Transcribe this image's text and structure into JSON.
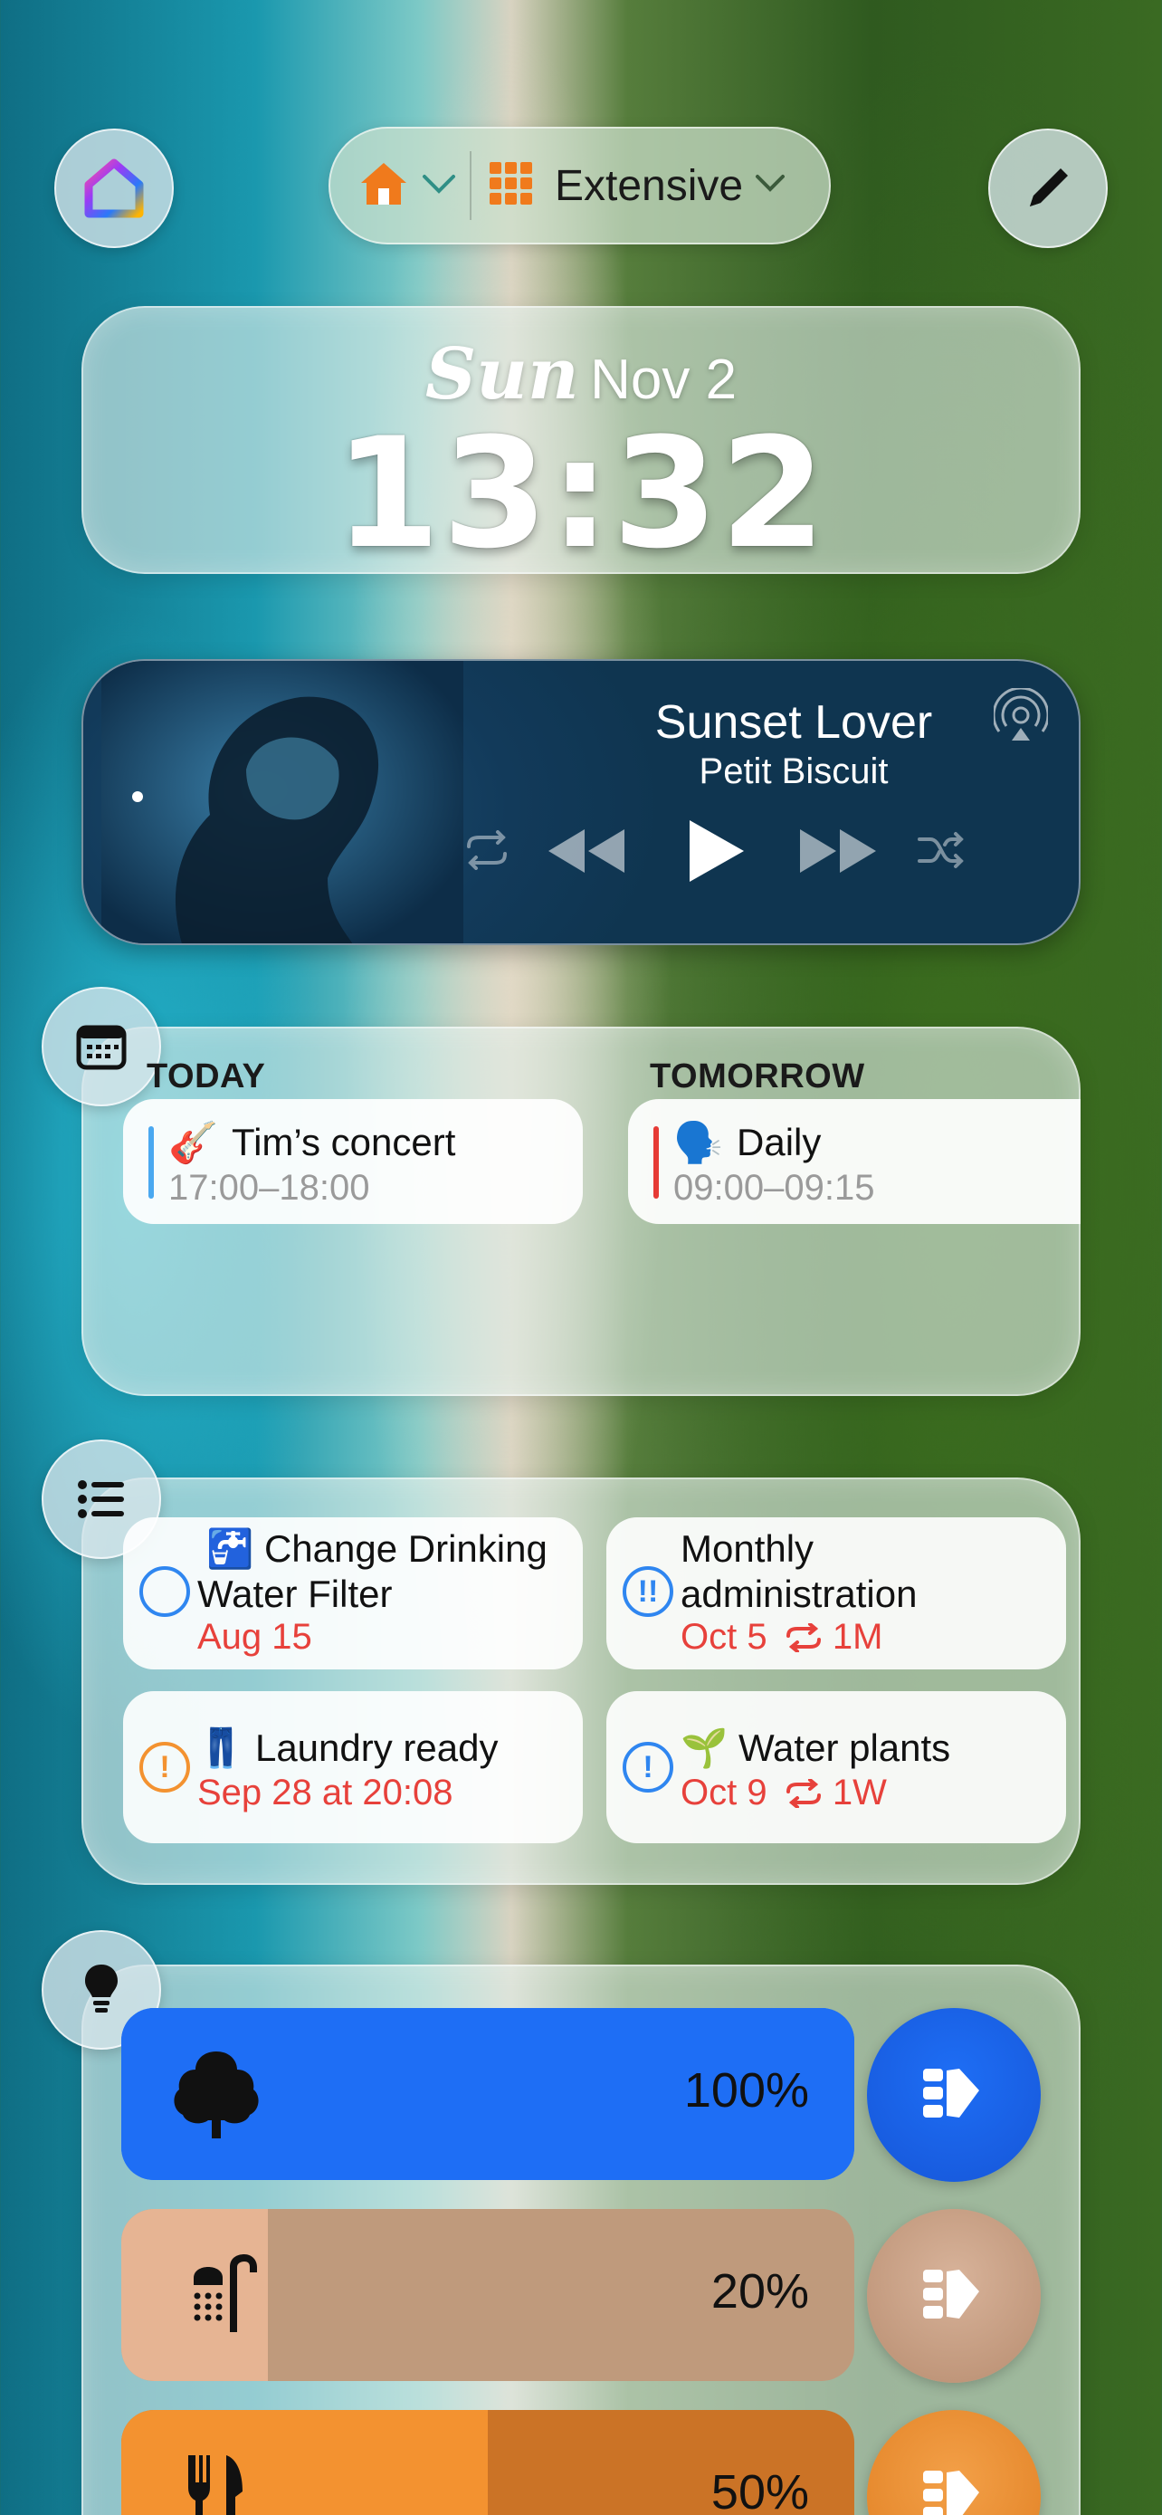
{
  "header": {
    "space_label": "Extensive",
    "colors": {
      "home_orange": "#f07a1c"
    }
  },
  "clock": {
    "day": "Sun",
    "date": "Nov 2",
    "time": "13:32"
  },
  "music": {
    "title": "Sunset Lover",
    "artist": "Petit Biscuit"
  },
  "calendar": {
    "today_heading": "TODAY",
    "tomorrow_heading": "TOMORROW",
    "today_event": {
      "emoji": "🎸",
      "title": "Tim’s concert",
      "time": "17:00–18:00",
      "color": "#4aa8f0"
    },
    "tomorrow_event": {
      "emoji": "🗣️",
      "title": "Daily",
      "time": "09:00–09:15",
      "color": "#e63a35"
    }
  },
  "reminders": [
    {
      "emoji": "🚰",
      "title": "Change Drinking Water Filter",
      "title_line1": "Change Drinking",
      "title_line2": "Water Filter",
      "due": "Aug 15",
      "priority": "",
      "repeat": ""
    },
    {
      "emoji": "",
      "title": "Monthly administration",
      "title_line1": "Monthly",
      "title_line2": "administration",
      "due": "Oct 5",
      "priority": "!!",
      "repeat": "1M"
    },
    {
      "emoji": "👖",
      "title": "Laundry ready",
      "due": "Sep 28 at 20:08",
      "priority": "!",
      "repeat": ""
    },
    {
      "emoji": "🌱",
      "title": "Water plants",
      "due": "Oct 9",
      "priority": "!",
      "repeat": "1W"
    }
  ],
  "lights": [
    {
      "icon": "tree-icon",
      "percent": "100%",
      "level": 1.0,
      "fill": "#1e6ef5",
      "track": "#1e6ef5",
      "button": "#1a6cf0"
    },
    {
      "icon": "shower-icon",
      "percent": "20%",
      "level": 0.2,
      "fill": "#e6b493",
      "track": "#bf9a7c",
      "button": "#c8a086"
    },
    {
      "icon": "fork-knife-icon",
      "percent": "50%",
      "level": 0.5,
      "fill": "#f39230",
      "track": "#cb7326",
      "button": "#ec8e35"
    }
  ]
}
